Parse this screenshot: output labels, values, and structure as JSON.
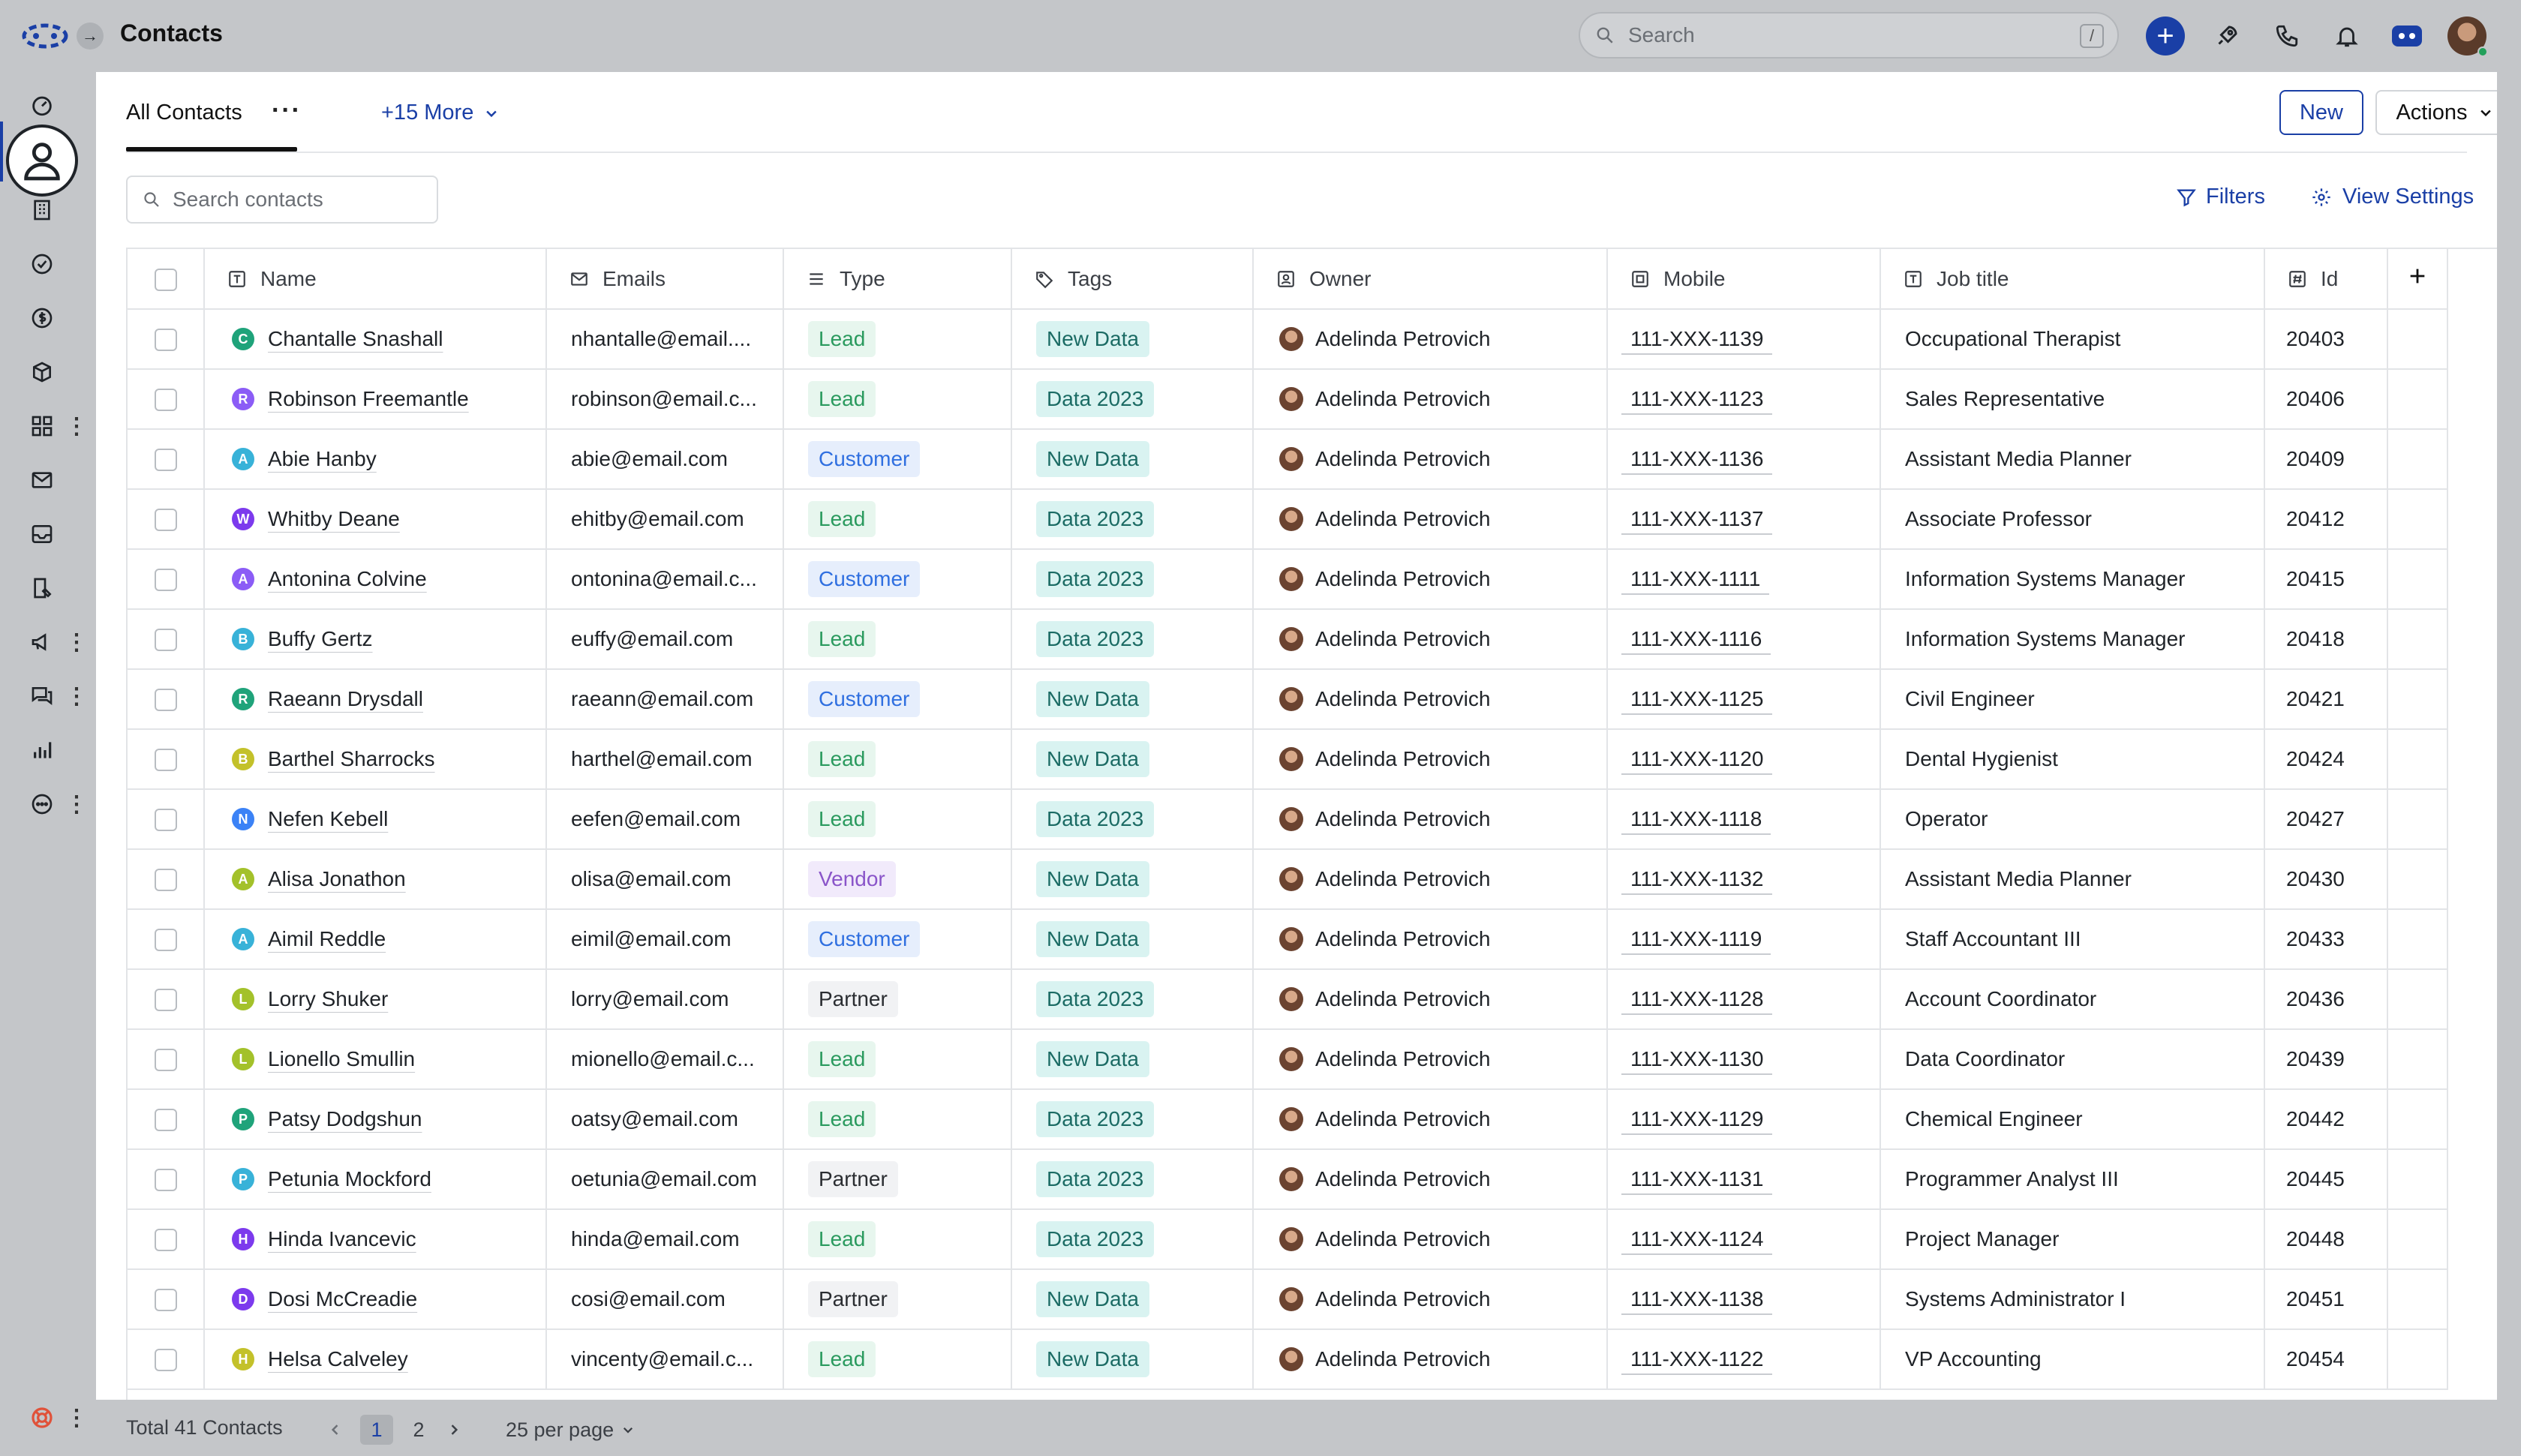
{
  "header": {
    "title": "Contacts",
    "search_placeholder": "Search",
    "search_shortcut": "/"
  },
  "sidebar": {
    "items": [
      "dashboard-icon",
      "contacts-icon",
      "building-icon",
      "check-circle-icon",
      "dollar-icon",
      "box-icon",
      "apps-icon",
      "mail-icon",
      "inbox-icon",
      "form-icon",
      "megaphone-icon",
      "chat-icon",
      "chart-icon",
      "more-circle-icon",
      "help-icon"
    ]
  },
  "tabs": {
    "all_contacts": "All Contacts",
    "more": "+15 More"
  },
  "toolbar": {
    "new_label": "New",
    "actions_label": "Actions",
    "search_placeholder": "Search contacts",
    "filters_label": "Filters",
    "view_settings_label": "View Settings"
  },
  "table": {
    "columns": [
      "Name",
      "Emails",
      "Type",
      "Tags",
      "Owner",
      "Mobile",
      "Job title",
      "Id"
    ],
    "rows": [
      {
        "initial": "C",
        "color": "#1fa37a",
        "name": "Chantalle Snashall",
        "email": "nhantalle@email....",
        "type": "Lead",
        "tag": "New Data",
        "owner": "Adelinda Petrovich",
        "mobile": "111-XXX-1139",
        "job": "Occupational Therapist",
        "id": "20403"
      },
      {
        "initial": "R",
        "color": "#8b5cf6",
        "name": "Robinson Freemantle",
        "email": "robinson@email.c...",
        "type": "Lead",
        "tag": "Data 2023",
        "owner": "Adelinda Petrovich",
        "mobile": "111-XXX-1123",
        "job": "Sales Representative",
        "id": "20406"
      },
      {
        "initial": "A",
        "color": "#38b2d8",
        "name": "Abie Hanby",
        "email": "abie@email.com",
        "type": "Customer",
        "tag": "New Data",
        "owner": "Adelinda Petrovich",
        "mobile": "111-XXX-1136",
        "job": "Assistant Media Planner",
        "id": "20409"
      },
      {
        "initial": "W",
        "color": "#7c3aed",
        "name": "Whitby Deane",
        "email": "ehitby@email.com",
        "type": "Lead",
        "tag": "Data 2023",
        "owner": "Adelinda Petrovich",
        "mobile": "111-XXX-1137",
        "job": "Associate Professor",
        "id": "20412"
      },
      {
        "initial": "A",
        "color": "#8b5cf6",
        "name": "Antonina Colvine",
        "email": "ontonina@email.c...",
        "type": "Customer",
        "tag": "Data 2023",
        "owner": "Adelinda Petrovich",
        "mobile": "111-XXX-1111",
        "job": "Information Systems Manager",
        "id": "20415"
      },
      {
        "initial": "B",
        "color": "#38b2d8",
        "name": "Buffy Gertz",
        "email": "euffy@email.com",
        "type": "Lead",
        "tag": "Data 2023",
        "owner": "Adelinda Petrovich",
        "mobile": "111-XXX-1116",
        "job": "Information Systems Manager",
        "id": "20418"
      },
      {
        "initial": "R",
        "color": "#1fa37a",
        "name": "Raeann Drysdall",
        "email": "raeann@email.com",
        "type": "Customer",
        "tag": "New Data",
        "owner": "Adelinda Petrovich",
        "mobile": "111-XXX-1125",
        "job": "Civil Engineer",
        "id": "20421"
      },
      {
        "initial": "B",
        "color": "#c3c12a",
        "name": "Barthel Sharrocks",
        "email": "harthel@email.com",
        "type": "Lead",
        "tag": "New Data",
        "owner": "Adelinda Petrovich",
        "mobile": "111-XXX-1120",
        "job": "Dental Hygienist",
        "id": "20424"
      },
      {
        "initial": "N",
        "color": "#3b82f6",
        "name": "Nefen Kebell",
        "email": "eefen@email.com",
        "type": "Lead",
        "tag": "Data 2023",
        "owner": "Adelinda Petrovich",
        "mobile": "111-XXX-1118",
        "job": "Operator",
        "id": "20427"
      },
      {
        "initial": "A",
        "color": "#a3c12a",
        "name": "Alisa Jonathon",
        "email": "olisa@email.com",
        "type": "Vendor",
        "tag": "New Data",
        "owner": "Adelinda Petrovich",
        "mobile": "111-XXX-1132",
        "job": "Assistant Media Planner",
        "id": "20430"
      },
      {
        "initial": "A",
        "color": "#38b2d8",
        "name": "Aimil Reddle",
        "email": "eimil@email.com",
        "type": "Customer",
        "tag": "New Data",
        "owner": "Adelinda Petrovich",
        "mobile": "111-XXX-1119",
        "job": "Staff Accountant III",
        "id": "20433"
      },
      {
        "initial": "L",
        "color": "#a3c12a",
        "name": "Lorry Shuker",
        "email": "lorry@email.com",
        "type": "Partner",
        "tag": "Data 2023",
        "owner": "Adelinda Petrovich",
        "mobile": "111-XXX-1128",
        "job": "Account Coordinator",
        "id": "20436"
      },
      {
        "initial": "L",
        "color": "#a3c12a",
        "name": "Lionello Smullin",
        "email": "mionello@email.c...",
        "type": "Lead",
        "tag": "New Data",
        "owner": "Adelinda Petrovich",
        "mobile": "111-XXX-1130",
        "job": "Data Coordinator",
        "id": "20439"
      },
      {
        "initial": "P",
        "color": "#1fa37a",
        "name": "Patsy Dodgshun",
        "email": "oatsy@email.com",
        "type": "Lead",
        "tag": "Data 2023",
        "owner": "Adelinda Petrovich",
        "mobile": "111-XXX-1129",
        "job": "Chemical Engineer",
        "id": "20442"
      },
      {
        "initial": "P",
        "color": "#38b2d8",
        "name": "Petunia Mockford",
        "email": "oetunia@email.com",
        "type": "Partner",
        "tag": "Data 2023",
        "owner": "Adelinda Petrovich",
        "mobile": "111-XXX-1131",
        "job": "Programmer Analyst III",
        "id": "20445"
      },
      {
        "initial": "H",
        "color": "#7c3aed",
        "name": "Hinda Ivancevic",
        "email": "hinda@email.com",
        "type": "Lead",
        "tag": "Data 2023",
        "owner": "Adelinda Petrovich",
        "mobile": "111-XXX-1124",
        "job": "Project Manager",
        "id": "20448"
      },
      {
        "initial": "D",
        "color": "#7c3aed",
        "name": "Dosi McCreadie",
        "email": "cosi@email.com",
        "type": "Partner",
        "tag": "New Data",
        "owner": "Adelinda Petrovich",
        "mobile": "111-XXX-1138",
        "job": "Systems Administrator I",
        "id": "20451"
      },
      {
        "initial": "H",
        "color": "#c3c12a",
        "name": "Helsa Calveley",
        "email": "vincenty@email.c...",
        "type": "Lead",
        "tag": "New Data",
        "owner": "Adelinda Petrovich",
        "mobile": "111-XXX-1122",
        "job": "VP Accounting",
        "id": "20454"
      }
    ]
  },
  "footer": {
    "total": "Total 41 Contacts",
    "page_current": "1",
    "page_next": "2",
    "per_page": "25 per page"
  }
}
